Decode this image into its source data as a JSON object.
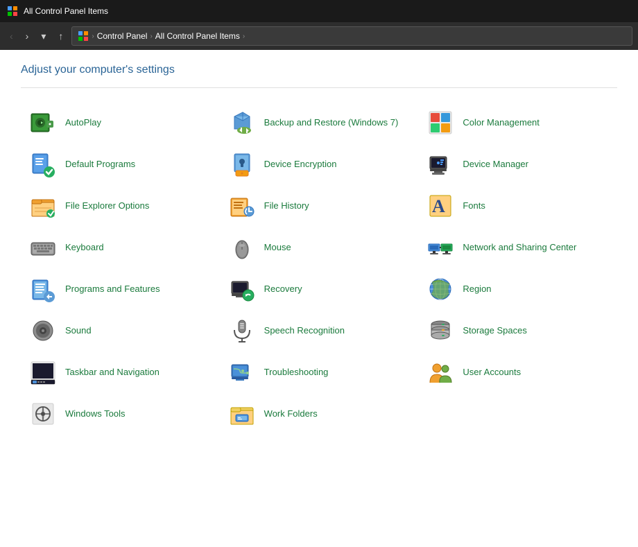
{
  "titlebar": {
    "icon": "⚙",
    "title": "All Control Panel Items"
  },
  "addressbar": {
    "crumbs": [
      "Control Panel",
      "All Control Panel Items"
    ],
    "chevron": "›"
  },
  "page": {
    "title": "Adjust your computer's settings"
  },
  "items": [
    {
      "id": "autoplay",
      "label": "AutoPlay",
      "icon": "autoplay"
    },
    {
      "id": "backup-restore",
      "label": "Backup and Restore (Windows 7)",
      "icon": "backup"
    },
    {
      "id": "color-management",
      "label": "Color Management",
      "icon": "color"
    },
    {
      "id": "default-programs",
      "label": "Default Programs",
      "icon": "default-programs"
    },
    {
      "id": "device-encryption",
      "label": "Device Encryption",
      "icon": "encryption"
    },
    {
      "id": "device-manager",
      "label": "Device Manager",
      "icon": "device-manager"
    },
    {
      "id": "file-explorer-options",
      "label": "File Explorer Options",
      "icon": "file-explorer"
    },
    {
      "id": "file-history",
      "label": "File History",
      "icon": "file-history"
    },
    {
      "id": "fonts",
      "label": "Fonts",
      "icon": "fonts"
    },
    {
      "id": "keyboard",
      "label": "Keyboard",
      "icon": "keyboard"
    },
    {
      "id": "mouse",
      "label": "Mouse",
      "icon": "mouse"
    },
    {
      "id": "network-sharing",
      "label": "Network and Sharing Center",
      "icon": "network"
    },
    {
      "id": "programs-features",
      "label": "Programs and Features",
      "icon": "programs"
    },
    {
      "id": "recovery",
      "label": "Recovery",
      "icon": "recovery"
    },
    {
      "id": "region",
      "label": "Region",
      "icon": "region"
    },
    {
      "id": "sound",
      "label": "Sound",
      "icon": "sound"
    },
    {
      "id": "speech-recognition",
      "label": "Speech Recognition",
      "icon": "speech"
    },
    {
      "id": "storage-spaces",
      "label": "Storage Spaces",
      "icon": "storage"
    },
    {
      "id": "taskbar-navigation",
      "label": "Taskbar and Navigation",
      "icon": "taskbar"
    },
    {
      "id": "troubleshooting",
      "label": "Troubleshooting",
      "icon": "troubleshooting"
    },
    {
      "id": "user-accounts",
      "label": "User Accounts",
      "icon": "users"
    },
    {
      "id": "windows-tools",
      "label": "Windows Tools",
      "icon": "windows-tools"
    },
    {
      "id": "work-folders",
      "label": "Work Folders",
      "icon": "work-folders"
    }
  ],
  "nav": {
    "back": "‹",
    "forward": "›",
    "dropdown": "▾",
    "up": "↑"
  }
}
